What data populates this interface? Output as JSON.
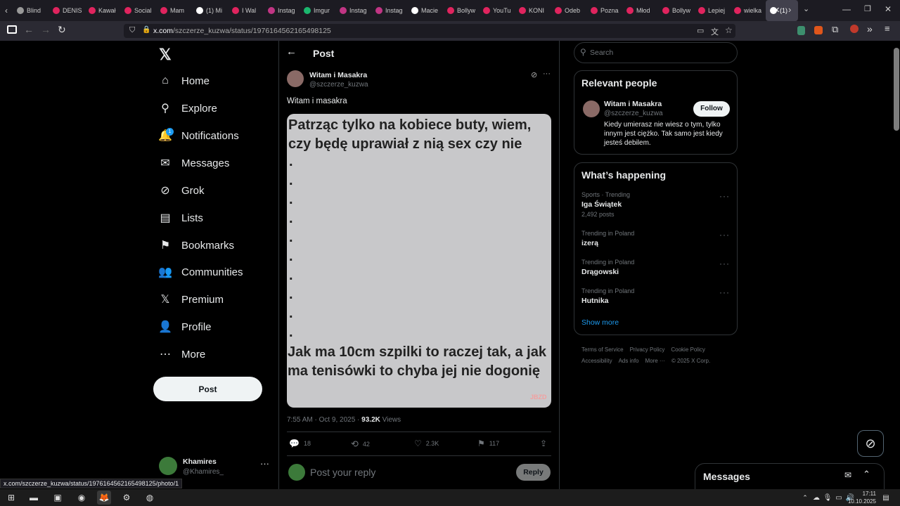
{
  "browser": {
    "tabs": [
      {
        "label": "Blind",
        "color": "#999"
      },
      {
        "label": "DENIS",
        "color": "#e0245e"
      },
      {
        "label": "Kawał",
        "color": "#e0245e"
      },
      {
        "label": "Social",
        "color": "#e0245e"
      },
      {
        "label": "Mam",
        "color": "#e0245e"
      },
      {
        "label": "(1) Mi",
        "color": "#fff"
      },
      {
        "label": "I Wal",
        "color": "#e0245e"
      },
      {
        "label": "Instag",
        "color": "#c13584"
      },
      {
        "label": "Imgur",
        "color": "#1bb76e"
      },
      {
        "label": "Instag",
        "color": "#c13584"
      },
      {
        "label": "Instag",
        "color": "#c13584"
      },
      {
        "label": "Macie",
        "color": "#fff"
      },
      {
        "label": "Bollyw",
        "color": "#e0245e"
      },
      {
        "label": "YouTu",
        "color": "#e0245e"
      },
      {
        "label": "KONI",
        "color": "#e0245e"
      },
      {
        "label": "Odeb",
        "color": "#e0245e"
      },
      {
        "label": "Pozna",
        "color": "#e0245e"
      },
      {
        "label": "Młod",
        "color": "#e0245e"
      },
      {
        "label": "Bollyw",
        "color": "#e0245e"
      },
      {
        "label": "Lepiej",
        "color": "#e0245e"
      },
      {
        "label": "wielka",
        "color": "#e0245e"
      },
      {
        "label": "(1)",
        "color": "#fff"
      }
    ],
    "url_host": "x.com",
    "url_path": "/szczerze_kuzwa/status/1976164562165498125",
    "status_url": "x.com/szczerze_kuzwa/status/1976164562165498125/photo/1"
  },
  "nav": {
    "items": [
      {
        "label": "Home",
        "icon": "home-icon",
        "glyph": "⌂"
      },
      {
        "label": "Explore",
        "icon": "search-icon",
        "glyph": "⚲"
      },
      {
        "label": "Notifications",
        "icon": "bell-icon",
        "glyph": "🔔"
      },
      {
        "label": "Messages",
        "icon": "envelope-icon",
        "glyph": "✉"
      },
      {
        "label": "Grok",
        "icon": "grok-icon",
        "glyph": "⊘"
      },
      {
        "label": "Lists",
        "icon": "list-icon",
        "glyph": "▤"
      },
      {
        "label": "Bookmarks",
        "icon": "bookmark-icon",
        "glyph": "⚑"
      },
      {
        "label": "Communities",
        "icon": "people-icon",
        "glyph": "👥"
      },
      {
        "label": "Premium",
        "icon": "x-logo-icon",
        "glyph": "𝕏"
      },
      {
        "label": "Profile",
        "icon": "person-icon",
        "glyph": "👤"
      },
      {
        "label": "More",
        "icon": "more-circle-icon",
        "glyph": "⋯"
      }
    ],
    "notification_badge": "1",
    "post_button": "Post",
    "account_name": "Khamires",
    "account_handle": "@Khamires_"
  },
  "post": {
    "header_title": "Post",
    "author_name": "Witam i Masakra",
    "author_handle": "@szczerze_kuzwa",
    "text": "Witam i masakra",
    "image_top_text": "Patrząc tylko na kobiece buty, wiem, czy będę uprawiał z nią sex czy nie",
    "image_dots": [
      ".",
      ".",
      ".",
      ".",
      ".",
      ".",
      ".",
      ".",
      ".",
      "."
    ],
    "image_bottom_text": "Jak ma 10cm szpilki to raczej tak, a jak ma tenisówki to chyba jej nie dogonię",
    "watermark": "JBZD",
    "timestamp": "7:55 AM · Oct 9, 2025 ·",
    "views_count": "93.2K",
    "views_label": "Views",
    "replies": "18",
    "reposts": "42",
    "likes": "2.3K",
    "bookmarks": "117",
    "reply_placeholder": "Post your reply",
    "reply_button": "Reply"
  },
  "sidebar": {
    "search_placeholder": "Search",
    "relevant_title": "Relevant people",
    "person_name": "Witam i Masakra",
    "person_handle": "@szczerze_kuzwa",
    "person_bio": "Kiedy umierasz nie wiesz o tym, tylko innym jest ciężko. Tak samo jest kiedy jesteś debilem.",
    "follow_label": "Follow",
    "happening_title": "What’s happening",
    "trends": [
      {
        "category": "Sports · Trending",
        "name": "Iga Świątek",
        "count": "2,492 posts"
      },
      {
        "category": "Trending in Poland",
        "name": "izerą",
        "count": ""
      },
      {
        "category": "Trending in Poland",
        "name": "Drągowski",
        "count": ""
      },
      {
        "category": "Trending in Poland",
        "name": "Hutnika",
        "count": ""
      }
    ],
    "show_more": "Show more",
    "footer_links": [
      "Terms of Service",
      "Privacy Policy",
      "Cookie Policy",
      "Accessibility",
      "Ads info",
      "More ···",
      "© 2025 X Corp."
    ],
    "messages_title": "Messages"
  },
  "taskbar": {
    "time": "17:11",
    "date": "10.10.2025"
  }
}
